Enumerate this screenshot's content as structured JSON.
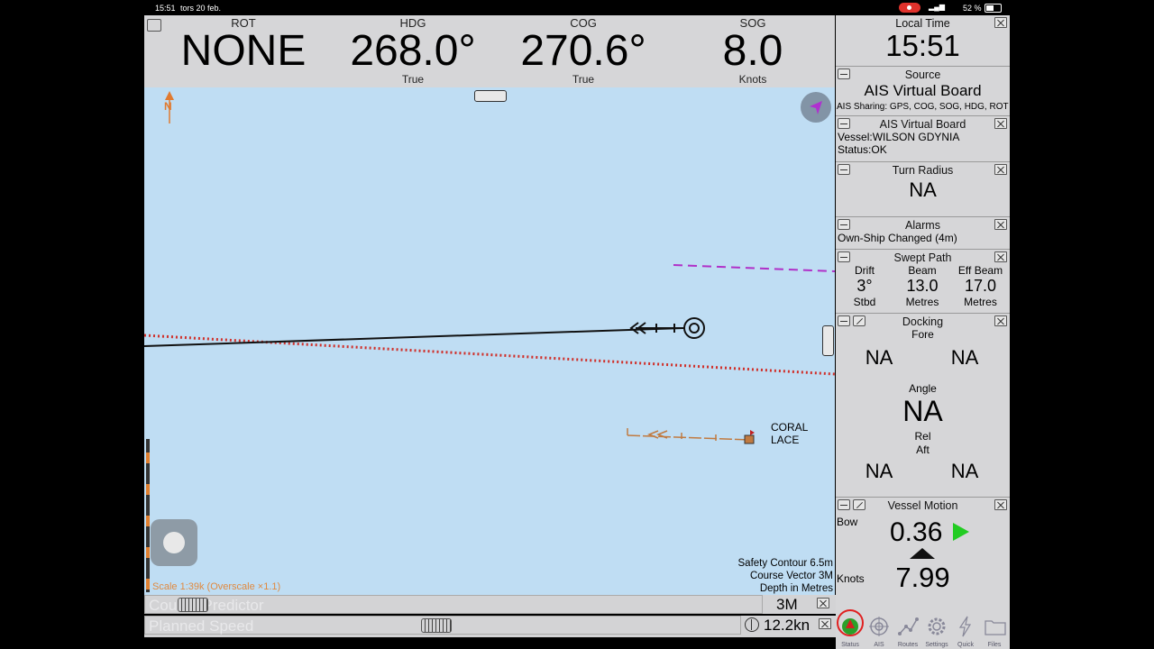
{
  "status_bar": {
    "time": "15:51",
    "date": "tors 20 feb.",
    "battery": "52 %"
  },
  "instruments": [
    {
      "label": "ROT",
      "value": "NONE",
      "unit": ""
    },
    {
      "label": "HDG",
      "value": "268.0°",
      "unit": "True"
    },
    {
      "label": "COG",
      "value": "270.6°",
      "unit": "True"
    },
    {
      "label": "SOG",
      "value": "8.0",
      "unit": "Knots"
    }
  ],
  "chart": {
    "north_label": "N",
    "target_label": "CORAL LACE",
    "scale": "Scale 1:39k (Overscale ×1.1)",
    "info": [
      "Safety Contour 6.5m",
      "Course Vector 3M",
      "Depth in Metres"
    ],
    "colors": {
      "water": "#bfddf3",
      "route": "#d0302a",
      "route_dashed": "#b030c8",
      "target": "#c07a40"
    }
  },
  "panels": {
    "local_time": {
      "title": "Local Time",
      "value": "15:51"
    },
    "source": {
      "title": "Source",
      "value": "AIS Virtual Board",
      "note": "AIS Sharing: GPS, COG, SOG, HDG, ROT"
    },
    "ais_board": {
      "title": "AIS Virtual Board",
      "vessel": "Vessel:WILSON GDYNIA",
      "status": "Status:OK"
    },
    "turn_radius": {
      "title": "Turn Radius",
      "value": "NA"
    },
    "alarms": {
      "title": "Alarms",
      "message": "Own-Ship Changed (4m)"
    },
    "swept_path": {
      "title": "Swept Path",
      "columns": [
        {
          "label": "Drift",
          "value": "3°",
          "unit": "Stbd"
        },
        {
          "label": "Beam",
          "value": "13.0",
          "unit": "Metres"
        },
        {
          "label": "Eff Beam",
          "value": "17.0",
          "unit": "Metres"
        }
      ]
    },
    "docking": {
      "title": "Docking",
      "fore_label": "Fore",
      "fore_left": "NA",
      "fore_right": "NA",
      "angle_label": "Angle",
      "angle_value": "NA",
      "rel_label": "Rel",
      "aft_label": "Aft",
      "aft_left": "NA",
      "aft_right": "NA"
    },
    "vessel_motion": {
      "title": "Vessel Motion",
      "bow_label": "Bow",
      "bow_value": "0.36",
      "knots_label": "Knots",
      "knots_value": "7.99"
    }
  },
  "bottom": {
    "predictor_label": "Course Predictor",
    "planned_label": "Planned Speed",
    "range_value": "3M",
    "speed_value": "12.2kn"
  },
  "tabs": [
    "Status",
    "AIS",
    "Routes",
    "Settings",
    "Quick",
    "Files"
  ]
}
